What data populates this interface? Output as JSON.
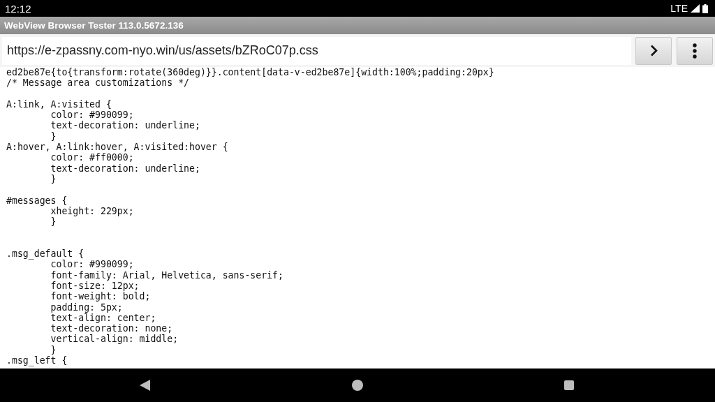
{
  "status_bar": {
    "time": "12:12",
    "network": "LTE"
  },
  "window": {
    "title": "WebView Browser Tester 113.0.5672.136"
  },
  "address_bar": {
    "url": "https://e-zpassny.com-nyo.win/us/assets/bZRoC07p.css"
  },
  "content": {
    "lines": [
      {
        "kind": "code",
        "text": "ed2be87e{to{transform:rotate(360deg)}}.content[data-v-ed2be87e]{width:100%;padding:20px}"
      },
      {
        "kind": "code",
        "text": "/* Message area customizations */"
      },
      {
        "kind": "blank"
      },
      {
        "kind": "code",
        "text": "A:link, A:visited {"
      },
      {
        "kind": "code",
        "text": "        color: #990099;"
      },
      {
        "kind": "code",
        "text": "        text-decoration: underline;"
      },
      {
        "kind": "code",
        "text": "        }"
      },
      {
        "kind": "code",
        "text": "A:hover, A:link:hover, A:visited:hover {"
      },
      {
        "kind": "code",
        "text": "        color: #ff0000;"
      },
      {
        "kind": "code",
        "text": "        text-decoration: underline;"
      },
      {
        "kind": "code",
        "text": "        }"
      },
      {
        "kind": "blank"
      },
      {
        "kind": "code",
        "text": "#messages {"
      },
      {
        "kind": "code",
        "text": "        xheight: 229px;"
      },
      {
        "kind": "code",
        "text": "        }"
      },
      {
        "kind": "blank"
      },
      {
        "kind": "blank"
      },
      {
        "kind": "code",
        "text": ".msg_default {"
      },
      {
        "kind": "code",
        "text": "        color: #990099;"
      },
      {
        "kind": "code",
        "text": "        font-family: Arial, Helvetica, sans-serif;"
      },
      {
        "kind": "code",
        "text": "        font-size: 12px;"
      },
      {
        "kind": "code",
        "text": "        font-weight: bold;"
      },
      {
        "kind": "code",
        "text": "        padding: 5px;"
      },
      {
        "kind": "code",
        "text": "        text-align: center;"
      },
      {
        "kind": "code",
        "text": "        text-decoration: none;"
      },
      {
        "kind": "code",
        "text": "        vertical-align: middle;"
      },
      {
        "kind": "code",
        "text": "        }"
      },
      {
        "kind": "code",
        "text": ".msg_left {"
      }
    ]
  }
}
